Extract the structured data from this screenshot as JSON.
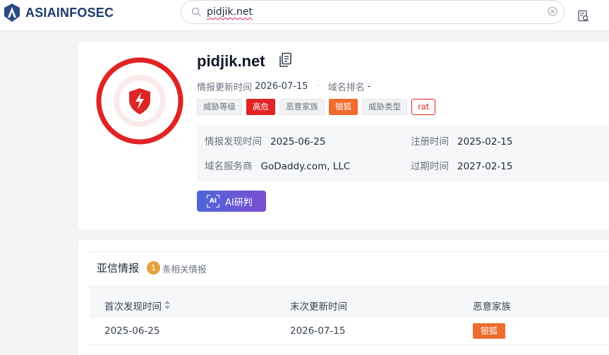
{
  "brand": {
    "name": "ASIAINFOSEC"
  },
  "search": {
    "value": "pidjik.net"
  },
  "domain": {
    "name": "pidjik.net",
    "update_label": "情报更新时间",
    "update_value": "2026-07-15",
    "rank_label": "域名排名",
    "rank_value": "-",
    "tags": [
      {
        "label": "威胁等级",
        "style": "gray"
      },
      {
        "label": "高危",
        "style": "red"
      },
      {
        "label": "恶意家族",
        "style": "gray"
      },
      {
        "label": "银狐",
        "style": "orange"
      },
      {
        "label": "威胁类型",
        "style": "gray"
      },
      {
        "label": "rat",
        "style": "outline-red"
      }
    ],
    "info": {
      "discover_label": "情报发现时间",
      "discover_value": "2025-06-25",
      "register_label": "注册时间",
      "register_value": "2025-02-15",
      "registrar_label": "域名服务商",
      "registrar_value": "GoDaddy.com, LLC",
      "expire_label": "过期时间",
      "expire_value": "2027-02-15"
    },
    "ai_button": "AI研判",
    "ai_glyph": "AI"
  },
  "intel": {
    "title": "亚信情报",
    "count": "1",
    "count_text": "条相关情报",
    "columns": [
      "首次发现时间",
      "末次更新时间",
      "恶意家族"
    ],
    "rows": [
      {
        "first_seen": "2025-06-25",
        "last_update": "2026-07-15",
        "family": "银狐"
      }
    ]
  },
  "colors": {
    "danger": "#e02424",
    "orange": "#ef6c2f",
    "brand": "#1e3a6d",
    "ai_start": "#4f65d8",
    "ai_end": "#7b4fd3",
    "badge": "#e8a23b"
  }
}
